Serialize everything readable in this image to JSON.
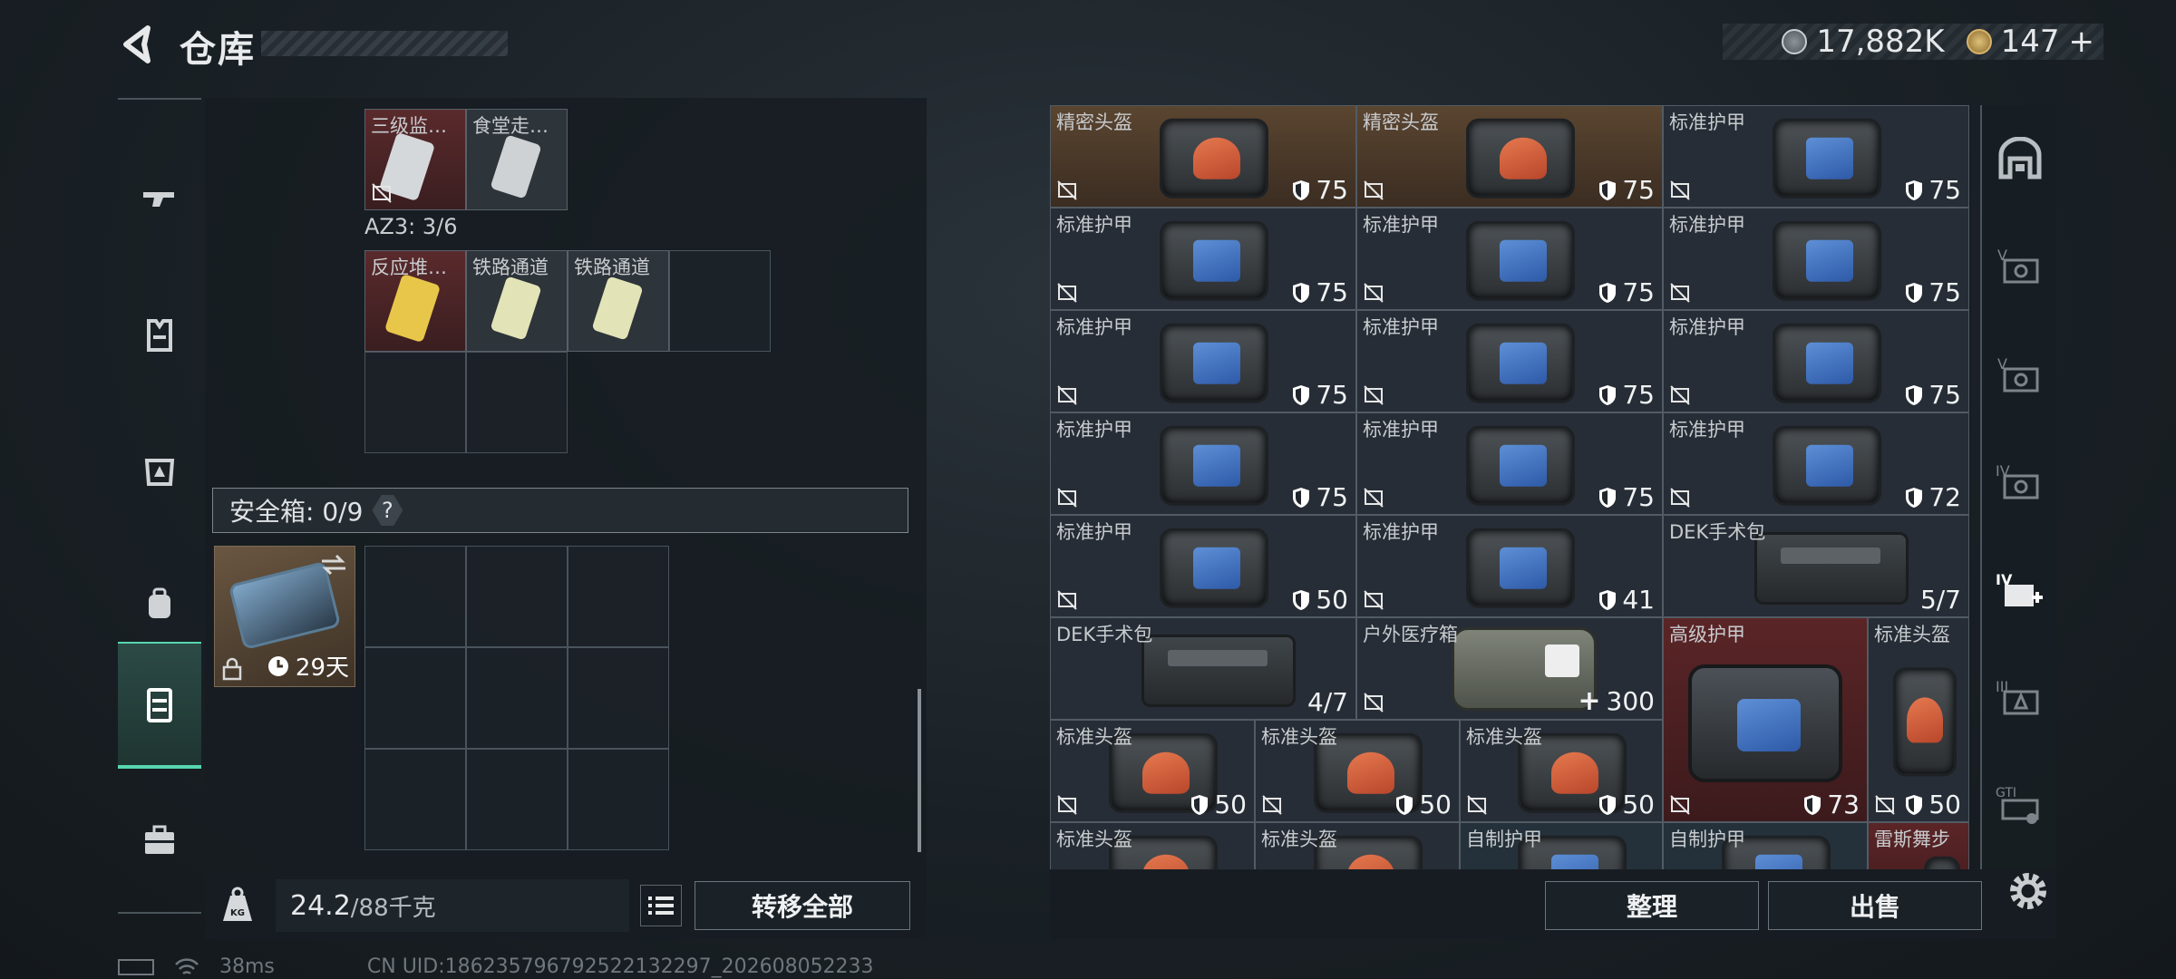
{
  "header": {
    "title": "仓库",
    "silver": "17,882K",
    "gold": "147",
    "gold_plus": "+"
  },
  "leftnav": [
    "gun-icon",
    "armor-icon",
    "chest-rig-icon",
    "backpack-icon",
    "safe-box-icon",
    "briefcase-icon"
  ],
  "keys_top": [
    {
      "name": "三级监狱…"
    },
    {
      "name": "食堂走廊间"
    }
  ],
  "az3": "AZ3: 3/6",
  "keys_az3": [
    {
      "name": "反应堆总…"
    },
    {
      "name": "铁路通道"
    },
    {
      "name": "铁路通道"
    }
  ],
  "safe": {
    "label": "安全箱: 0/9",
    "help": "?",
    "days": "29天"
  },
  "weight": {
    "value": "24.2",
    "cap": "/88千克"
  },
  "transfer_all": "转移全部",
  "items": [
    {
      "name": "精密头盔",
      "dur": "75",
      "type": "helmet",
      "bg": "brown"
    },
    {
      "name": "精密头盔",
      "dur": "75",
      "type": "helmet",
      "bg": "brown"
    },
    {
      "name": "标准护甲",
      "dur": "75",
      "type": "vest"
    },
    {
      "name": "标准护甲",
      "dur": "75",
      "type": "vest"
    },
    {
      "name": "标准护甲",
      "dur": "75",
      "type": "vest"
    },
    {
      "name": "标准护甲",
      "dur": "75",
      "type": "vest"
    },
    {
      "name": "标准护甲",
      "dur": "75",
      "type": "vest"
    },
    {
      "name": "标准护甲",
      "dur": "75",
      "type": "vest"
    },
    {
      "name": "标准护甲",
      "dur": "75",
      "type": "vest"
    },
    {
      "name": "标准护甲",
      "dur": "75",
      "type": "vest"
    },
    {
      "name": "标准护甲",
      "dur": "75",
      "type": "vest"
    },
    {
      "name": "标准护甲",
      "dur": "72",
      "type": "vest"
    },
    {
      "name": "标准护甲",
      "dur": "50",
      "type": "vest"
    },
    {
      "name": "标准护甲",
      "dur": "41",
      "type": "vest"
    },
    {
      "name": "DEK手术包",
      "dur": "5/7",
      "type": "kit"
    },
    {
      "name": "DEK手术包",
      "dur": "4/7",
      "type": "kit"
    },
    {
      "name": "户外医疗箱",
      "dur": "300",
      "type": "med"
    },
    {
      "name": "高级护甲",
      "dur": "73",
      "type": "big"
    },
    {
      "name": "标准头盔",
      "dur": "50",
      "type": "helmet-tall"
    },
    {
      "name": "标准头盔",
      "dur": "50",
      "type": "helmet"
    },
    {
      "name": "标准头盔",
      "dur": "50",
      "type": "helmet"
    },
    {
      "name": "标准头盔",
      "dur": "50",
      "type": "helmet"
    },
    {
      "name": "标准头盔",
      "type": "helmet"
    },
    {
      "name": "标准头盔",
      "type": "helmet"
    },
    {
      "name": "自制护甲",
      "type": "vest"
    },
    {
      "name": "自制护甲",
      "type": "vest"
    },
    {
      "name": "雷斯舞步",
      "type": "misc"
    }
  ],
  "organize": "整理",
  "sell": "出售",
  "status": {
    "ping": "38ms",
    "uid": "CN UID:18623579679252213229​7_202608052233"
  },
  "colors": {
    "accent": "#58d6b0",
    "brown": "#5a4530",
    "red": "#5b2527"
  }
}
